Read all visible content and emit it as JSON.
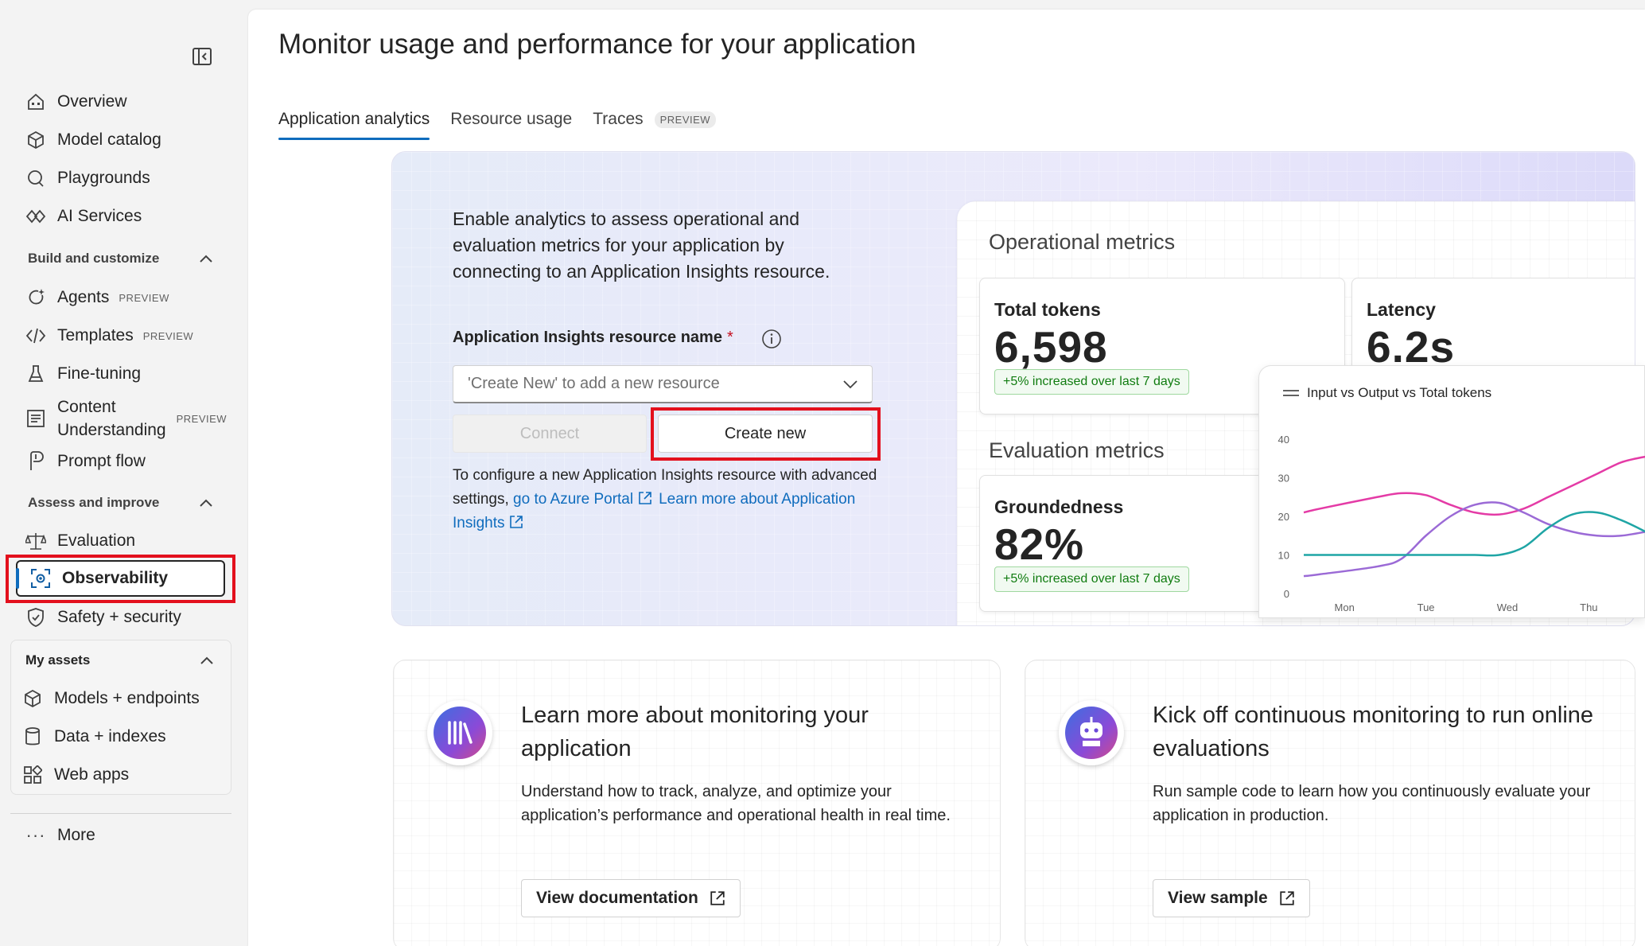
{
  "sidebar": {
    "items_top": [
      {
        "label": "Overview",
        "icon": "home-icon"
      },
      {
        "label": "Model catalog",
        "icon": "cube-icon"
      },
      {
        "label": "Playgrounds",
        "icon": "chat-icon"
      },
      {
        "label": "AI Services",
        "icon": "services-icon"
      }
    ],
    "build_section": "Build and customize",
    "build_items": [
      {
        "label": "Agents",
        "badge": "PREVIEW"
      },
      {
        "label": "Templates",
        "badge": "PREVIEW"
      },
      {
        "label": "Fine-tuning",
        "badge": ""
      },
      {
        "label_line1": "Content",
        "label_line2": "Understanding",
        "badge": "PREVIEW"
      },
      {
        "label": "Prompt flow",
        "badge": ""
      }
    ],
    "assess_section": "Assess and improve",
    "assess_items": [
      {
        "label": "Evaluation"
      },
      {
        "label": "Observability"
      },
      {
        "label": "Safety + security"
      }
    ],
    "assets_section": "My assets",
    "assets_items": [
      {
        "label": "Models + endpoints"
      },
      {
        "label": "Data + indexes"
      },
      {
        "label": "Web apps"
      }
    ],
    "more_label": "More",
    "more_glyph": "···"
  },
  "page": {
    "title": "Monitor usage and performance for your application",
    "tabs": [
      {
        "label": "Application analytics",
        "active": true
      },
      {
        "label": "Resource usage",
        "active": false
      },
      {
        "label": "Traces",
        "badge": "PREVIEW",
        "active": false
      }
    ]
  },
  "hero": {
    "intro": "Enable analytics to assess operational and evaluation metrics for your application by connecting to an Application Insights resource.",
    "field_label": "Application Insights resource name",
    "required_mark": "*",
    "dropdown_placeholder": "'Create New' to add a new resource",
    "connect_label": "Connect",
    "create_label": "Create new",
    "config_text": "To configure a new Application Insights resource with advanced settings,",
    "azure_link": "go to Azure Portal",
    "learn_link": "Learn more about Application Insights"
  },
  "metrics": {
    "operational_heading": "Operational metrics",
    "evaluation_heading": "Evaluation metrics",
    "total_tokens_label": "Total tokens",
    "total_tokens_value": "6,598",
    "total_tokens_badge": "+5% increased over last 7 days",
    "latency_label": "Latency",
    "latency_value": "6.2s",
    "groundedness_label": "Groundedness",
    "groundedness_value": "82%",
    "groundedness_badge": "+5% increased over last 7 days"
  },
  "chart_data": {
    "type": "line",
    "title": "Input vs Output vs Total tokens",
    "categories": [
      "Mon",
      "Tue",
      "Wed",
      "Thu"
    ],
    "x_positions": [
      0.0,
      0.4,
      1.8,
      2.4,
      3.0,
      3.6,
      4.2,
      4.8,
      5.4,
      6.0,
      6.6,
      7.2,
      7.8,
      8.4
    ],
    "x_tick_positions": [
      1.0,
      3.0,
      5.0,
      7.0
    ],
    "ylim": [
      0,
      40
    ],
    "yticks": [
      0,
      10,
      20,
      30,
      40
    ],
    "grid": false,
    "series": [
      {
        "color": "#e43ba6",
        "values": [
          21,
          22,
          25,
          26,
          25.5,
          23,
          21,
          20.5,
          22,
          25,
          28,
          31,
          34,
          35.5
        ]
      },
      {
        "color": "#9b6ad6",
        "values": [
          4.5,
          5,
          7,
          9,
          15,
          20,
          23,
          23.5,
          21,
          18,
          16,
          15,
          15,
          16
        ]
      },
      {
        "color": "#1fa5a5",
        "values": [
          10,
          10,
          10,
          10,
          10,
          10,
          10,
          10,
          12,
          17,
          20.5,
          21,
          19,
          16
        ]
      }
    ]
  },
  "cards": [
    {
      "title": "Learn more about monitoring your application",
      "desc": "Understand how to track, analyze, and optimize your application’s performance and operational health in real time.",
      "button": "View documentation"
    },
    {
      "title": "Kick off continuous monitoring to run online evaluations",
      "desc": "Run sample code to learn how you continuously evaluate your application in production.",
      "button": "View sample"
    }
  ]
}
